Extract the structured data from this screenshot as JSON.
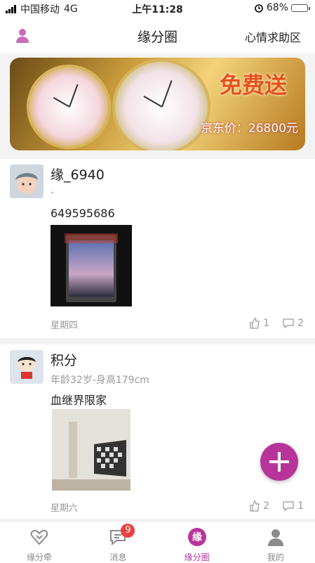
{
  "status": {
    "carrier": "中国移动",
    "network": "4G",
    "time": "上午11:28",
    "battery": "68%"
  },
  "header": {
    "title": "缘分圈",
    "right_link": "心情求助区"
  },
  "banner": {
    "promo": "免费送",
    "price": "京东价：26800元"
  },
  "posts": [
    {
      "name": "缘_6940",
      "info": "-",
      "text": "649595686",
      "day": "星期四",
      "likes": "1",
      "comments": "2"
    },
    {
      "name": "积分",
      "info": "年龄32岁-身高179cm",
      "text": "血继界限家",
      "day": "星期六",
      "likes": "2",
      "comments": "1"
    }
  ],
  "tabs": [
    {
      "label": "缘分牵",
      "icon": "heart-bracket-icon"
    },
    {
      "label": "消息",
      "icon": "message-icon",
      "badge": "9"
    },
    {
      "label": "缘分圈",
      "icon": "yuan-circle-icon",
      "glyph": "缘"
    },
    {
      "label": "我的",
      "icon": "person-icon"
    }
  ],
  "colors": {
    "accent": "#b7359b",
    "badge": "#e94141"
  }
}
